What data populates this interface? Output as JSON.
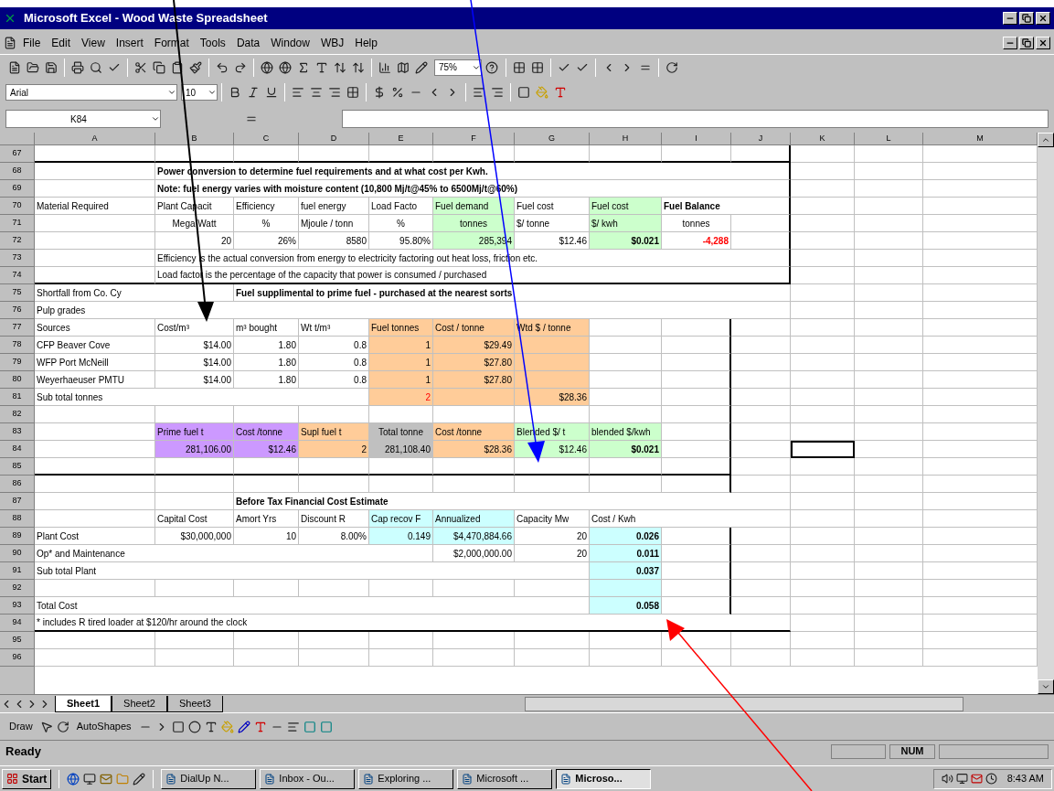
{
  "window": {
    "title": "Microsoft Excel - Wood Waste Spreadsheet"
  },
  "menu": [
    "File",
    "Edit",
    "View",
    "Insert",
    "Format",
    "Tools",
    "Data",
    "Window",
    "WBJ",
    "Help"
  ],
  "toolbar": {
    "zoom": "75%"
  },
  "format_toolbar": {
    "font": "Arial",
    "size": "10"
  },
  "name_box": "K84",
  "columns": [
    "A",
    "B",
    "C",
    "D",
    "E",
    "F",
    "G",
    "H",
    "I",
    "J",
    "K",
    "L",
    "M"
  ],
  "rows": [
    {
      "number": "67",
      "cells": {}
    },
    {
      "number": "68",
      "cells": {
        "B": {
          "text": "Power conversion to determine fuel requirements and at what cost per Kwh.",
          "kind": "text",
          "bold": true
        }
      }
    },
    {
      "number": "69",
      "cells": {
        "B": {
          "text": "Note: fuel energy varies with moisture content (10,800 Mj/t@45% to 6500Mj/t@60%)",
          "kind": "text",
          "bold": true
        }
      }
    },
    {
      "number": "70",
      "cells": {
        "A": {
          "text": "Material Required",
          "kind": "text"
        },
        "B": {
          "text": "Plant Capacit",
          "kind": "text"
        },
        "C": {
          "text": "Efficiency",
          "kind": "text"
        },
        "D": {
          "text": "fuel energy",
          "kind": "text"
        },
        "E": {
          "text": "Load Facto",
          "kind": "text"
        },
        "F": {
          "text": "Fuel demand",
          "kind": "text",
          "color": "#ccffcc"
        },
        "G": {
          "text": "Fuel cost",
          "kind": "text"
        },
        "H": {
          "text": "Fuel cost",
          "kind": "text",
          "color": "#ccffcc"
        },
        "I": {
          "text": "Fuel Balance",
          "kind": "text",
          "bold": true
        }
      }
    },
    {
      "number": "71",
      "cells": {
        "B": {
          "text": "Mega Watt",
          "kind": "center"
        },
        "C": {
          "text": "%",
          "kind": "center"
        },
        "D": {
          "text": "Mjoule / tonn",
          "kind": "text"
        },
        "E": {
          "text": "%",
          "kind": "center"
        },
        "F": {
          "text": "tonnes",
          "kind": "center",
          "color": "#ccffcc"
        },
        "G": {
          "text": "$/ tonne",
          "kind": "text"
        },
        "H": {
          "text": "$/ kwh",
          "kind": "text",
          "color": "#ccffcc"
        },
        "I": {
          "text": "tonnes",
          "kind": "center"
        }
      }
    },
    {
      "number": "72",
      "cells": {
        "B": {
          "text": "20",
          "kind": "number"
        },
        "C": {
          "text": "26%",
          "kind": "number"
        },
        "D": {
          "text": "8580",
          "kind": "number"
        },
        "E": {
          "text": "95.80%",
          "kind": "number"
        },
        "F": {
          "text": "285,394",
          "kind": "number",
          "color": "#ccffcc"
        },
        "G": {
          "text": "$12.46",
          "kind": "number"
        },
        "H": {
          "text": "$0.021",
          "kind": "number",
          "bold": true,
          "color": "#ccffcc"
        },
        "I": {
          "text": "-4,288",
          "kind": "number",
          "bold": true,
          "alert": true
        }
      }
    },
    {
      "number": "73",
      "cells": {
        "B": {
          "text": "Efficiency is the actual conversion from energy to electricity factoring out heat loss, friction etc.",
          "kind": "text"
        }
      }
    },
    {
      "number": "74",
      "cells": {
        "B": {
          "text": "Load factor is the percentage of the capacity that power is consumed / purchased",
          "kind": "text"
        }
      }
    },
    {
      "number": "75",
      "cells": {
        "A": {
          "text": "Shortfall from Co. Cy",
          "kind": "text"
        },
        "C": {
          "text": "Fuel supplimental to prime fuel - purchased at the nearest sorts",
          "kind": "text",
          "bold": true
        }
      }
    },
    {
      "number": "76",
      "cells": {
        "A": {
          "text": "Pulp grades",
          "kind": "text"
        }
      }
    },
    {
      "number": "77",
      "cells": {
        "A": {
          "text": "Sources",
          "kind": "text"
        },
        "B": {
          "text": "Cost/m³",
          "kind": "text"
        },
        "C": {
          "text": "m³ bought",
          "kind": "text"
        },
        "D": {
          "text": "Wt  t/m³",
          "kind": "text"
        },
        "E": {
          "text": "Fuel tonnes",
          "kind": "text",
          "color": "#ffcc99"
        },
        "F": {
          "text": "Cost / tonne",
          "kind": "text",
          "color": "#ffcc99"
        },
        "G": {
          "text": "Wtd $ / tonne",
          "kind": "text",
          "color": "#ffcc99"
        }
      }
    },
    {
      "number": "78",
      "cells": {
        "A": {
          "text": "CFP Beaver Cove",
          "kind": "text"
        },
        "B": {
          "text": "$14.00",
          "kind": "number"
        },
        "C": {
          "text": "1.80",
          "kind": "number"
        },
        "D": {
          "text": "0.8",
          "kind": "number"
        },
        "E": {
          "text": "1",
          "kind": "number",
          "color": "#ffcc99"
        },
        "F": {
          "text": "$29.49",
          "kind": "number",
          "color": "#ffcc99"
        },
        "G": {
          "kind": "number",
          "color": "#ffcc99"
        }
      }
    },
    {
      "number": "79",
      "cells": {
        "A": {
          "text": "WFP Port McNeill",
          "kind": "text"
        },
        "B": {
          "text": "$14.00",
          "kind": "number"
        },
        "C": {
          "text": "1.80",
          "kind": "number"
        },
        "D": {
          "text": "0.8",
          "kind": "number"
        },
        "E": {
          "text": "1",
          "kind": "number",
          "color": "#ffcc99"
        },
        "F": {
          "text": "$27.80",
          "kind": "number",
          "color": "#ffcc99"
        },
        "G": {
          "kind": "number",
          "color": "#ffcc99"
        }
      }
    },
    {
      "number": "80",
      "cells": {
        "A": {
          "text": "Weyerhaeuser PMTU",
          "kind": "text"
        },
        "B": {
          "text": "$14.00",
          "kind": "number"
        },
        "C": {
          "text": "1.80",
          "kind": "number"
        },
        "D": {
          "text": "0.8",
          "kind": "number"
        },
        "E": {
          "text": "1",
          "kind": "number",
          "color": "#ffcc99"
        },
        "F": {
          "text": "$27.80",
          "kind": "number",
          "color": "#ffcc99"
        },
        "G": {
          "kind": "number",
          "color": "#ffcc99"
        }
      }
    },
    {
      "number": "81",
      "cells": {
        "A": {
          "text": "Sub total tonnes",
          "kind": "text"
        },
        "E": {
          "text": "2",
          "kind": "number",
          "alert": true,
          "color": "#ffcc99"
        },
        "F": {
          "kind": "number",
          "color": "#ffcc99"
        },
        "G": {
          "text": "$28.36",
          "kind": "number",
          "color": "#ffcc99"
        }
      }
    },
    {
      "number": "82",
      "cells": {}
    },
    {
      "number": "83",
      "cells": {
        "B": {
          "text": "Prime fuel t",
          "kind": "text",
          "color": "#cc99ff"
        },
        "C": {
          "text": "Cost /tonne",
          "kind": "text",
          "color": "#cc99ff"
        },
        "D": {
          "text": "Supl fuel t",
          "kind": "text",
          "color": "#ffcc99"
        },
        "E": {
          "text": "Total tonne",
          "kind": "center",
          "color": "#c0c0c0"
        },
        "F": {
          "text": "Cost /tonne",
          "kind": "text",
          "color": "#ffcc99"
        },
        "G": {
          "text": "Blended $/ t",
          "kind": "text",
          "color": "#ccffcc"
        },
        "H": {
          "text": "blended $/kwh",
          "kind": "text",
          "color": "#ccffcc"
        }
      }
    },
    {
      "number": "84",
      "cells": {
        "B": {
          "text": "281,106.00",
          "kind": "number",
          "color": "#cc99ff"
        },
        "C": {
          "text": "$12.46",
          "kind": "number",
          "color": "#cc99ff"
        },
        "D": {
          "text": "2",
          "kind": "number",
          "color": "#ffcc99"
        },
        "E": {
          "text": "281,108.40",
          "kind": "number",
          "color": "#c0c0c0"
        },
        "F": {
          "text": "$28.36",
          "kind": "number",
          "color": "#ffcc99"
        },
        "G": {
          "text": "$12.46",
          "kind": "number",
          "color": "#ccffcc"
        },
        "H": {
          "text": "$0.021",
          "kind": "number",
          "bold": true,
          "color": "#ccffcc"
        },
        "K": {
          "selected": true
        }
      }
    },
    {
      "number": "85",
      "cells": {}
    },
    {
      "number": "86",
      "cells": {}
    },
    {
      "number": "87",
      "cells": {
        "C": {
          "text": "Before Tax Financial Cost Estimate",
          "kind": "text",
          "bold": true
        }
      }
    },
    {
      "number": "88",
      "cells": {
        "B": {
          "text": "Capital Cost",
          "kind": "text"
        },
        "C": {
          "text": "Amort Yrs",
          "kind": "text"
        },
        "D": {
          "text": "Discount R",
          "kind": "text"
        },
        "E": {
          "text": "Cap recov F",
          "kind": "text",
          "color": "#ccffff"
        },
        "F": {
          "text": "Annualized",
          "kind": "text",
          "color": "#ccffff"
        },
        "G": {
          "text": "Capacity Mw",
          "kind": "text"
        },
        "H": {
          "text": "Cost / Kwh",
          "kind": "text"
        }
      }
    },
    {
      "number": "89",
      "cells": {
        "A": {
          "text": "Plant Cost",
          "kind": "text"
        },
        "B": {
          "text": "$30,000,000",
          "kind": "number"
        },
        "C": {
          "text": "10",
          "kind": "number"
        },
        "D": {
          "text": "8.00%",
          "kind": "number"
        },
        "E": {
          "text": "0.149",
          "kind": "number",
          "color": "#ccffff"
        },
        "F": {
          "text": "$4,470,884.66",
          "kind": "number",
          "color": "#ccffff"
        },
        "G": {
          "text": "20",
          "kind": "number"
        },
        "H": {
          "text": "0.026",
          "kind": "number",
          "bold": true,
          "color": "#ccffff"
        }
      }
    },
    {
      "number": "90",
      "cells": {
        "A": {
          "text": "Op* and Maintenance",
          "kind": "text"
        },
        "F": {
          "text": "$2,000,000.00",
          "kind": "number"
        },
        "G": {
          "text": "20",
          "kind": "number"
        },
        "H": {
          "text": "0.011",
          "kind": "number",
          "bold": true,
          "color": "#ccffff"
        }
      }
    },
    {
      "number": "91",
      "cells": {
        "A": {
          "text": "Sub total Plant",
          "kind": "text"
        },
        "H": {
          "text": "0.037",
          "kind": "number",
          "bold": true,
          "color": "#ccffff"
        }
      }
    },
    {
      "number": "92",
      "cells": {
        "H": {
          "kind": "number",
          "color": "#ccffff"
        }
      }
    },
    {
      "number": "93",
      "cells": {
        "A": {
          "text": "Total Cost",
          "kind": "text"
        },
        "H": {
          "text": "0.058",
          "kind": "number",
          "bold": true,
          "color": "#ccffff"
        }
      }
    },
    {
      "number": "94",
      "cells": {
        "A": {
          "text": "* includes R tired loader at $120/hr around the clock",
          "kind": "text"
        }
      }
    },
    {
      "number": "95",
      "cells": {}
    },
    {
      "number": "96",
      "cells": {}
    }
  ],
  "sheet_tabs": [
    {
      "label": "Sheet1",
      "selected": true
    },
    {
      "label": "Sheet2",
      "selected": false
    },
    {
      "label": "Sheet3",
      "selected": false
    }
  ],
  "drawing_toolbar": {
    "draw": "Draw",
    "autoshapes": "AutoShapes"
  },
  "status_bar": {
    "text": "Ready",
    "indicator": "NUM"
  },
  "taskbar": {
    "start": "Start",
    "tasks": [
      {
        "label": "DialUp N...",
        "selected": false
      },
      {
        "label": "Inbox - Ou...",
        "selected": false
      },
      {
        "label": "Exploring ...",
        "selected": false
      },
      {
        "label": "Microsoft ...",
        "selected": false
      },
      {
        "label": "Microso...",
        "selected": true
      }
    ],
    "clock": "8:43 AM"
  }
}
